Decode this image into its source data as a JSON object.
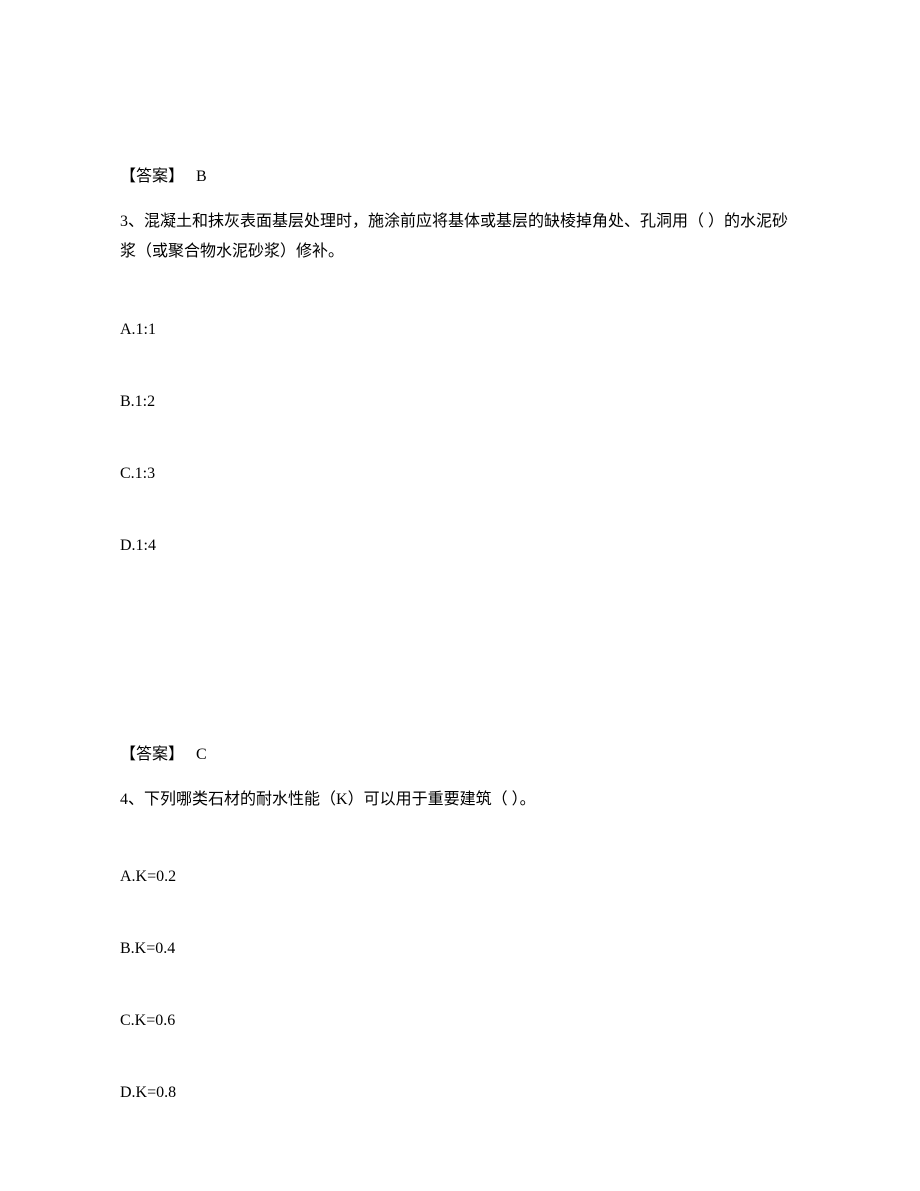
{
  "q2": {
    "answer_label": "【答案】",
    "answer_value": "B"
  },
  "q3": {
    "number_prefix": "3、",
    "text": "混凝土和抹灰表面基层处理时，施涂前应将基体或基层的缺棱掉角处、孔洞用（ ）的水泥砂浆（或聚合物水泥砂浆）修补。",
    "options": {
      "a": "A.1:1",
      "b": "B.1:2",
      "c": "C.1:3",
      "d": "D.1:4"
    },
    "answer_label": "【答案】",
    "answer_value": "C"
  },
  "q4": {
    "number_prefix": "4、",
    "text": "下列哪类石材的耐水性能（K）可以用于重要建筑（ ）。",
    "options": {
      "a": "A.K=0.2",
      "b": "B.K=0.4",
      "c": "C.K=0.6",
      "d": "D.K=0.8"
    }
  }
}
